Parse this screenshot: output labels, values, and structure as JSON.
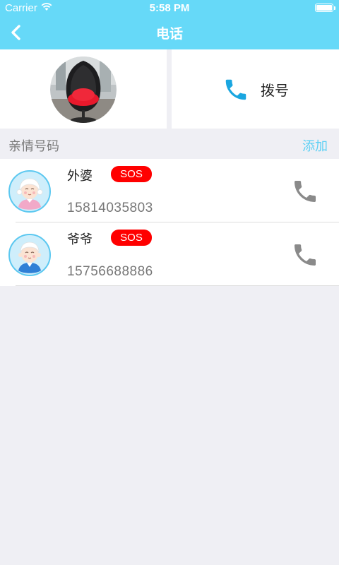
{
  "status_bar": {
    "carrier": "Carrier",
    "time": "5:58 PM"
  },
  "nav": {
    "title": "电话",
    "back_icon": "chevron-left-icon"
  },
  "dial": {
    "label": "拨号",
    "icon": "phone-icon"
  },
  "section": {
    "title": "亲情号码",
    "add_label": "添加"
  },
  "contacts": [
    {
      "name": "外婆",
      "badge": "SOS",
      "number": "15814035803"
    },
    {
      "name": "爷爷",
      "badge": "SOS",
      "number": "15756688886"
    }
  ],
  "colors": {
    "header": "#66d9f8",
    "accent": "#5dd0f4",
    "sos": "#ff0000",
    "call_icon": "#8a8a8a",
    "dial_icon": "#1aa6e0"
  }
}
